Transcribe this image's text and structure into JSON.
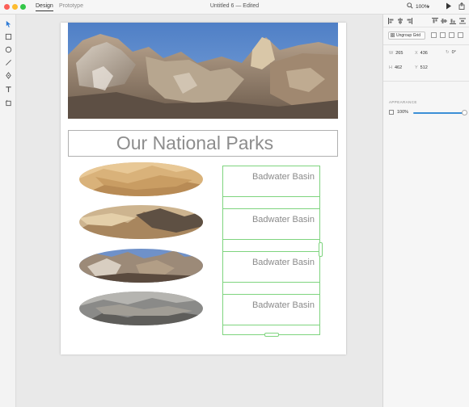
{
  "window": {
    "title": "Untitled 6",
    "status": "Edited",
    "title_line": "Untitled 6 — Edited"
  },
  "modes": {
    "design_label": "Design",
    "prototype_label": "Prototype",
    "active": "Design"
  },
  "toolbar_right": {
    "zoom_label": "100%",
    "icons": [
      "search-icon",
      "zoom-dropdown",
      "play-icon",
      "share-icon"
    ]
  },
  "tools": [
    "select-tool",
    "rectangle-tool",
    "ellipse-tool",
    "line-tool",
    "pen-tool",
    "text-tool",
    "artboard-tool"
  ],
  "artboard": {
    "heading": "Our National Parks",
    "repeat_grid": {
      "cell_label": "Badwater Basin",
      "cells": [
        "Badwater Basin",
        "Badwater Basin",
        "Badwater Basin",
        "Badwater Basin"
      ]
    },
    "ovals": [
      "dunes-photo",
      "sand-canyon-photo",
      "rock-formation-photo",
      "gray-badlands-photo"
    ]
  },
  "properties": {
    "ungroup_label": "Ungroup Grid",
    "w_key": "W",
    "w": "265",
    "x_key": "X",
    "x": "436",
    "rotation": "0°",
    "h_key": "H",
    "h": "462",
    "y_key": "Y",
    "y": "512",
    "appearance_label": "APPEARANCE",
    "opacity": "100%",
    "opacity_level": 1.0
  },
  "colors": {
    "selection": "#7ed47e",
    "slider": "#3b8fd6",
    "heading": "#8d8d8d"
  }
}
